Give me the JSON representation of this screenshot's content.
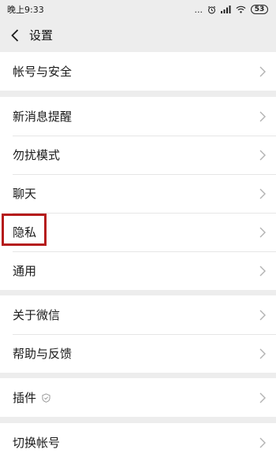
{
  "status_bar": {
    "time": "晚上9:33",
    "dots": "...",
    "alarm_icon": "alarm-icon",
    "signal_icon": "signal-icon",
    "wifi_icon": "wifi-icon",
    "battery_level": "53"
  },
  "nav": {
    "title": "设置"
  },
  "groups": [
    {
      "items": [
        {
          "label": "帐号与安全"
        }
      ]
    },
    {
      "items": [
        {
          "label": "新消息提醒"
        },
        {
          "label": "勿扰模式"
        },
        {
          "label": "聊天"
        },
        {
          "label": "隐私"
        },
        {
          "label": "通用"
        }
      ]
    },
    {
      "items": [
        {
          "label": "关于微信"
        },
        {
          "label": "帮助与反馈"
        }
      ]
    },
    {
      "items": [
        {
          "label": "插件"
        }
      ]
    },
    {
      "items": [
        {
          "label": "切换帐号"
        }
      ]
    }
  ],
  "colors": {
    "background": "#ededed",
    "cell": "#ffffff",
    "highlight": "#b51b1b",
    "chevron": "#b2b2b2"
  }
}
